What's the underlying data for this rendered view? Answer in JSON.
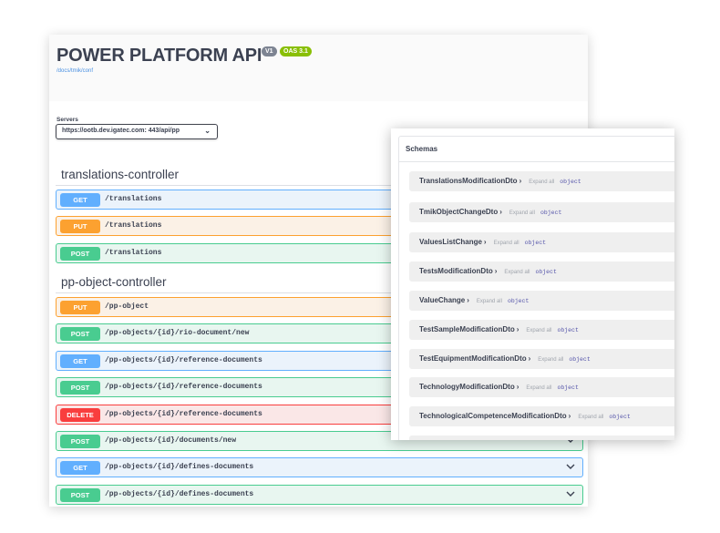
{
  "info": {
    "title": "POWER PLATFORM API",
    "version_badge": "V1",
    "oas_badge": "OAS 3.1",
    "docs_link": "/docs/tmik/conf"
  },
  "servers": {
    "label": "Servers",
    "selected": "https://ootb.dev.igatec.com: 443/api/pp"
  },
  "tags": [
    {
      "name": "translations-controller",
      "operations": [
        {
          "method": "GET",
          "path": "/translations"
        },
        {
          "method": "PUT",
          "path": "/translations"
        },
        {
          "method": "POST",
          "path": "/translations"
        }
      ]
    },
    {
      "name": "pp-object-controller",
      "operations": [
        {
          "method": "PUT",
          "path": "/pp-object"
        },
        {
          "method": "POST",
          "path": "/pp-objects/{id}/rio-document/new"
        },
        {
          "method": "GET",
          "path": "/pp-objects/{id}/reference-documents"
        },
        {
          "method": "POST",
          "path": "/pp-objects/{id}/reference-documents"
        },
        {
          "method": "DELETE",
          "path": "/pp-objects/{id}/reference-documents"
        },
        {
          "method": "POST",
          "path": "/pp-objects/{id}/documents/new"
        },
        {
          "method": "GET",
          "path": "/pp-objects/{id}/defines-documents"
        },
        {
          "method": "POST",
          "path": "/pp-objects/{id}/defines-documents"
        }
      ]
    }
  ],
  "method_colors": {
    "GET": "#61affe",
    "PUT": "#fca130",
    "POST": "#49cc90",
    "DELETE": "#f93e3e"
  },
  "icons": {
    "chevron": "chevron-down-icon",
    "schema_arrow": "chevron-right-icon"
  },
  "schemas": {
    "title": "Schemas",
    "items": [
      {
        "name": "TranslationsModificationDto",
        "expand": "Expand all",
        "type": "object"
      },
      {
        "name": "TmikObjectChangeDto",
        "expand": "Expand all",
        "type": "object"
      },
      {
        "name": "ValuesListChange",
        "expand": "Expand all",
        "type": "object"
      },
      {
        "name": "TestsModificationDto",
        "expand": "Expand all",
        "type": "object"
      },
      {
        "name": "ValueChange",
        "expand": "Expand all",
        "type": "object"
      },
      {
        "name": "TestSampleModificationDto",
        "expand": "Expand all",
        "type": "object"
      },
      {
        "name": "TestEquipmentModificationDto",
        "expand": "Expand all",
        "type": "object"
      },
      {
        "name": "TechnologyModificationDto",
        "expand": "Expand all",
        "type": "object"
      },
      {
        "name": "TechnologicalCompetenceModificationDto",
        "expand": "Expand all",
        "type": "object"
      }
    ]
  }
}
